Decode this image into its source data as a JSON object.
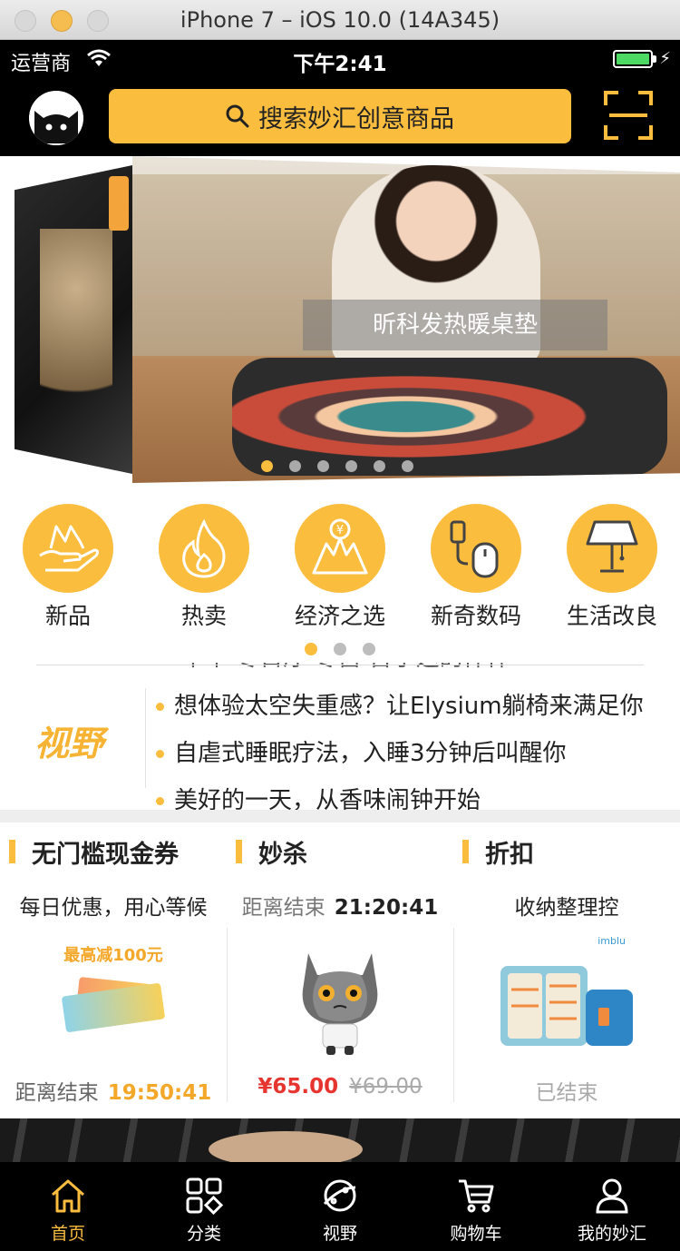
{
  "simulator": {
    "title": "iPhone 7 – iOS 10.0 (14A345)"
  },
  "status_bar": {
    "carrier": "运营商",
    "time": "下午2:41",
    "battery_percent": 100
  },
  "header": {
    "search_placeholder": "搜索妙汇创意商品"
  },
  "banner": {
    "caption": "昕科发热暖桌垫",
    "slide_count": 6,
    "active_index": 0
  },
  "categories": [
    {
      "label": "新品",
      "icon": "hand-icon"
    },
    {
      "label": "热卖",
      "icon": "flame-icon"
    },
    {
      "label": "经济之选",
      "icon": "yen-mountain-icon"
    },
    {
      "label": "新奇数码",
      "icon": "mouse-icon"
    },
    {
      "label": "生活改良",
      "icon": "lamp-icon"
    }
  ],
  "category_pages": {
    "count": 3,
    "active_index": 0
  },
  "vision": {
    "logo": "视野",
    "partial_item": "中华 冬日厅 冬宫 台子运的件件",
    "items": [
      "想体验太空失重感？让Elysium躺椅来满足你",
      "自虐式睡眠疗法，入睡3分钟后叫醒你",
      "美好的一天，从香味闹钟开始"
    ]
  },
  "deals": [
    {
      "title": "无门槛现金券",
      "subtitle": "每日优惠，用心等候",
      "image_text": "最高减100元",
      "footer_label": "距离结束",
      "footer_timer": "19:50:41"
    },
    {
      "title": "妙杀",
      "subtitle_label": "距离结束",
      "subtitle_timer": "21:20:41",
      "price": "¥65.00",
      "old_price": "¥69.00"
    },
    {
      "title": "折扣",
      "subtitle": "收纳整理控",
      "image_brand": "imblu",
      "footer": "已结束"
    }
  ],
  "tabbar": [
    {
      "label": "首页",
      "icon": "home-icon",
      "active": true
    },
    {
      "label": "分类",
      "icon": "category-icon",
      "active": false
    },
    {
      "label": "视野",
      "icon": "planet-icon",
      "active": false
    },
    {
      "label": "购物车",
      "icon": "cart-icon",
      "active": false
    },
    {
      "label": "我的妙汇",
      "icon": "user-icon",
      "active": false
    }
  ],
  "colors": {
    "accent": "#fbbd3e",
    "price": "#e6342f",
    "background_dark": "#000000"
  }
}
